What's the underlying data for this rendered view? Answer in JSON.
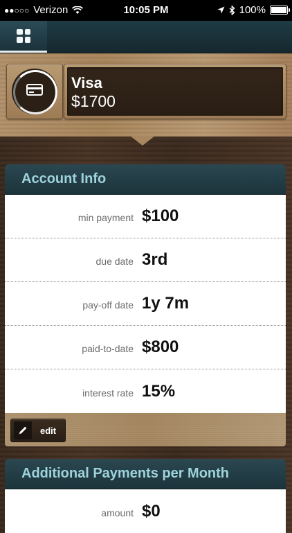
{
  "status_bar": {
    "signal_dots": "●●○○○",
    "carrier": "Verizon",
    "time": "10:05 PM",
    "battery": "100%",
    "battery_level": 1.0
  },
  "nav": {
    "menu_icon": "grid-icon"
  },
  "card": {
    "icon": "credit-card-icon",
    "name": "Visa",
    "amount": "$1700"
  },
  "account_info": {
    "title": "Account Info",
    "rows": [
      {
        "label": "min payment",
        "value": "$100"
      },
      {
        "label": "due date",
        "value": "3rd"
      },
      {
        "label": "pay-off date",
        "value": "1y 7m"
      },
      {
        "label": "paid-to-date",
        "value": "$800"
      },
      {
        "label": "interest rate",
        "value": "15%"
      }
    ],
    "edit_label": "edit"
  },
  "additional_payments": {
    "title": "Additional Payments per Month",
    "rows": [
      {
        "label": "amount",
        "value": "$0"
      }
    ]
  },
  "colors": {
    "section_title": "#9fd3db",
    "header_bg": "#1c343c",
    "wood": "#a88559"
  }
}
